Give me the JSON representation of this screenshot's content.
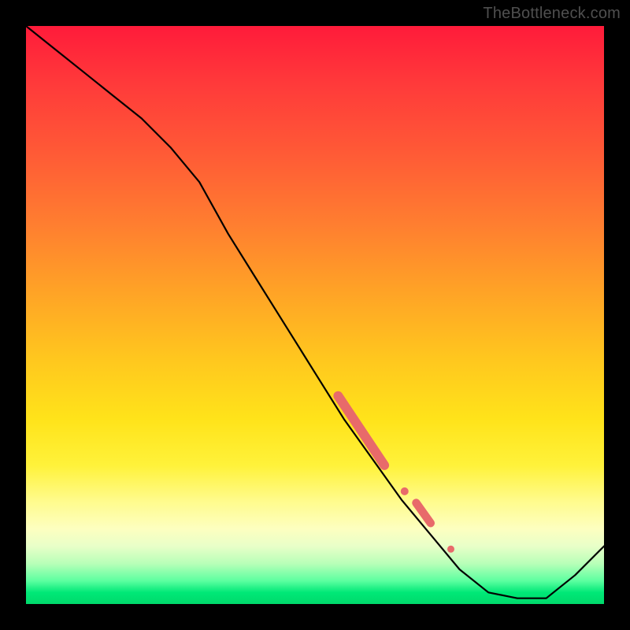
{
  "watermark": "TheBottleneck.com",
  "colors": {
    "curve": "#000000",
    "marker": "#e86a6a",
    "gradient_top": "#ff1b3a",
    "gradient_bottom": "#00d96b"
  },
  "chart_data": {
    "type": "line",
    "title": "",
    "xlabel": "",
    "ylabel": "",
    "xlim": [
      0,
      100
    ],
    "ylim": [
      0,
      100
    ],
    "grid": false,
    "legend": false,
    "annotations": [
      "TheBottleneck.com"
    ],
    "series": [
      {
        "name": "curve",
        "x": [
          0,
          5,
          10,
          15,
          20,
          25,
          30,
          35,
          40,
          45,
          50,
          55,
          60,
          65,
          70,
          75,
          80,
          85,
          90,
          95,
          100
        ],
        "y": [
          100,
          96,
          92,
          88,
          84,
          79,
          73,
          64,
          56,
          48,
          40,
          32,
          25,
          18,
          12,
          6,
          2,
          1,
          1,
          5,
          10
        ]
      }
    ],
    "markers": [
      {
        "shape": "capsule",
        "x0": 54,
        "y0": 36,
        "x1": 62,
        "y1": 24,
        "r": 6
      },
      {
        "shape": "dot",
        "x": 65.5,
        "y": 19.5,
        "r": 5
      },
      {
        "shape": "capsule",
        "x0": 67.5,
        "y0": 17.5,
        "x1": 70,
        "y1": 14,
        "r": 5.2
      },
      {
        "shape": "dot",
        "x": 73.5,
        "y": 9.5,
        "r": 4.5
      }
    ]
  }
}
